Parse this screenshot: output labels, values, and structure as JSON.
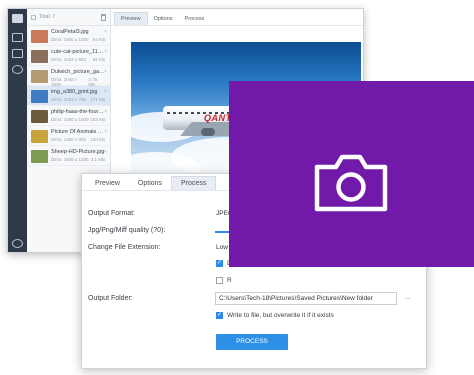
{
  "sidebar_rail": {
    "icons": [
      "app-logo-icon",
      "list-icon",
      "edit-icon",
      "play-icon",
      "settings-icon"
    ]
  },
  "file_list": {
    "header_label": "Total: 7",
    "files": [
      {
        "name": "CoralPetal3.jpg",
        "meta_left": "Dims: 1920 x 1080",
        "meta_right": "84 KB",
        "thumb_color": "#c97a5a",
        "selected": false
      },
      {
        "name": "cute-cat-picture_1122-...",
        "meta_left": "Dims: 1024 x 683",
        "meta_right": "62 KB",
        "thumb_color": "#8a6f5c",
        "selected": false
      },
      {
        "name": "Dulwich_picture_gallery...",
        "meta_left": "Dims: 2048 x 1536",
        "meta_right": "2.76 MB",
        "thumb_color": "#b59b73",
        "selected": false
      },
      {
        "name": "img_a380_jpmt.jpg",
        "meta_left": "Dims: 1024 x 768",
        "meta_right": "171 KB",
        "thumb_color": "#3f7cc4",
        "selected": true
      },
      {
        "name": "philip-haas-the-four-se...",
        "meta_left": "Dims: 1000 x 1000",
        "meta_right": "163 KB",
        "thumb_color": "#6b5a3e",
        "selected": false
      },
      {
        "name": "Picture Of Animals Pi...",
        "meta_left": "Dims: 1280 x 800",
        "meta_right": "120 KB",
        "thumb_color": "#c9a33c",
        "selected": false
      },
      {
        "name": "Sheep-HD-Picture.jpg",
        "meta_left": "Dims: 1920 x 1200",
        "meta_right": "3.1 MB",
        "thumb_color": "#7d9b52",
        "selected": false
      }
    ]
  },
  "preview_pane": {
    "tabs": [
      "Preview",
      "Options",
      "Process"
    ],
    "active_tab": "Preview",
    "photo_livery": "QANTAS"
  },
  "dialog": {
    "tabs": [
      "Preview",
      "Options",
      "Process"
    ],
    "active_tab": "Process",
    "output_format_label": "Output Format:",
    "output_format_value": "JPEG",
    "quality_label": "Jpg/Png/Miff quality (?0):",
    "extension_label": "Change File Extension:",
    "extension_value": "Low",
    "checkbox_a_label": "D",
    "checkbox_b_label": "R",
    "output_folder_label": "Output Folder:",
    "output_folder_value": "C:\\Users\\Tech-18\\Pictures\\Saved Pictures\\New folder",
    "browse_label": "...",
    "overwrite_label": "Write to file, but overwrite it if it exists",
    "process_button": "PROCESS"
  },
  "overlay": {
    "color": "#7119a9",
    "icon": "camera-icon"
  }
}
